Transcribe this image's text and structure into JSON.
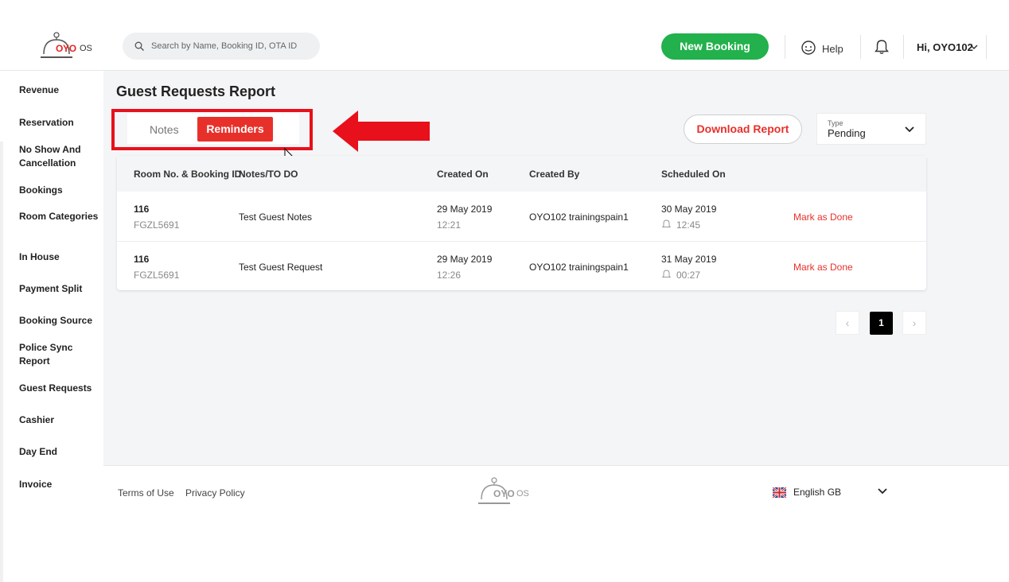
{
  "header": {
    "logo_text": "OYO",
    "logo_suffix": "OS",
    "search_placeholder": "Search by Name, Booking ID, OTA ID",
    "new_booking": "New Booking",
    "help": "Help",
    "user": "Hi, OYO102"
  },
  "sidebar": {
    "items": [
      {
        "label": "Revenue"
      },
      {
        "label": "Reservation"
      },
      {
        "label": "No Show And Cancellation"
      },
      {
        "label": "Bookings"
      },
      {
        "label": "Room Categories"
      },
      {
        "label": "In House"
      },
      {
        "label": "Payment Split"
      },
      {
        "label": "Booking Source"
      },
      {
        "label": "Police Sync Report"
      },
      {
        "label": "Guest Requests"
      },
      {
        "label": "Cashier"
      },
      {
        "label": "Day End"
      },
      {
        "label": "Invoice"
      }
    ]
  },
  "page": {
    "title": "Guest Requests Report",
    "tabs": {
      "notes": "Notes",
      "reminders": "Reminders"
    },
    "download": "Download Report",
    "type_label": "Type",
    "type_value": "Pending"
  },
  "table": {
    "headers": {
      "room": "Room No. & Booking ID",
      "notes": "Notes/TO DO",
      "created_on": "Created On",
      "created_by": "Created By",
      "scheduled_on": "Scheduled On"
    },
    "rows": [
      {
        "room": "116",
        "booking_id": "FGZL5691",
        "note": "Test Guest Notes",
        "created_date": "29 May 2019",
        "created_time": "12:21",
        "created_by": "OYO102 trainingspain1",
        "sched_date": "30 May 2019",
        "sched_time": "12:45",
        "action": "Mark as Done"
      },
      {
        "room": "116",
        "booking_id": "FGZL5691",
        "note": "Test Guest Request",
        "created_date": "29 May 2019",
        "created_time": "12:26",
        "created_by": "OYO102 trainingspain1",
        "sched_date": "31 May 2019",
        "sched_time": "00:27",
        "action": "Mark as Done"
      }
    ]
  },
  "pagination": {
    "current": "1",
    "prev": "‹",
    "next": "›"
  },
  "footer": {
    "terms": "Terms of Use",
    "privacy": "Privacy Policy",
    "logo_text": "OYO",
    "logo_suffix": "OS",
    "language": "English GB"
  },
  "colors": {
    "accent": "#e8302a",
    "primary_green": "#22b14c",
    "highlight_red": "#e8101a"
  }
}
